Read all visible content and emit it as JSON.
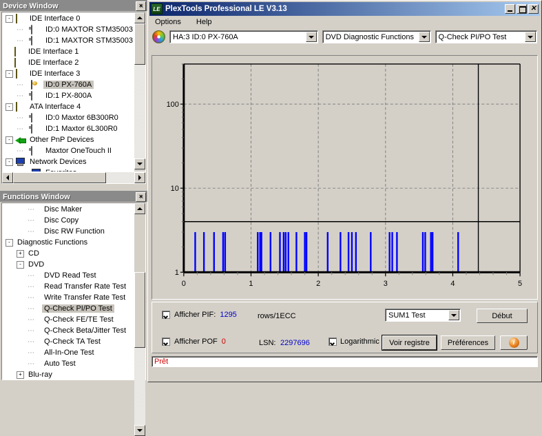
{
  "device_window": {
    "title": "Device Window",
    "close_label": "×",
    "items": [
      {
        "label": "IDE Interface 0",
        "indent": 0,
        "toggle": "-",
        "icon": "ide-card-icon",
        "selected": false
      },
      {
        "label": "ID:0  MAXTOR STM35003",
        "indent": 1,
        "toggle": "",
        "icon": "hard-drive-icon",
        "selected": false
      },
      {
        "label": "ID:1  MAXTOR STM35003",
        "indent": 1,
        "toggle": "",
        "icon": "hard-drive-icon",
        "selected": false
      },
      {
        "label": "IDE Interface 1",
        "indent": 0,
        "toggle": "",
        "icon": "ide-card-icon",
        "selected": false
      },
      {
        "label": "IDE Interface 2",
        "indent": 0,
        "toggle": "",
        "icon": "ide-card-icon",
        "selected": false
      },
      {
        "label": "IDE Interface 3",
        "indent": 0,
        "toggle": "-",
        "icon": "ide-card-icon",
        "selected": false
      },
      {
        "label": "ID:0  PX-760A",
        "indent": 1,
        "toggle": "",
        "icon": "dvd-drive-icon",
        "selected": true
      },
      {
        "label": "ID:1  PX-800A",
        "indent": 1,
        "toggle": "",
        "icon": "hard-drive-icon",
        "selected": false
      },
      {
        "label": "ATA Interface 4",
        "indent": 0,
        "toggle": "-",
        "icon": "ide-card-icon",
        "selected": false
      },
      {
        "label": "ID:0  Maxtor 6B300R0",
        "indent": 1,
        "toggle": "",
        "icon": "hard-drive-icon",
        "selected": false
      },
      {
        "label": "ID:1  Maxtor 6L300R0",
        "indent": 1,
        "toggle": "",
        "icon": "hard-drive-icon",
        "selected": false
      },
      {
        "label": "Other PnP Devices",
        "indent": 0,
        "toggle": "-",
        "icon": "pnp-plug-icon",
        "selected": false
      },
      {
        "label": "Maxtor  OneTouch II",
        "indent": 1,
        "toggle": "",
        "icon": "hard-drive-icon",
        "selected": false
      },
      {
        "label": "Network Devices",
        "indent": 0,
        "toggle": "-",
        "icon": "network-icon",
        "selected": false
      },
      {
        "label": "Favorites",
        "indent": 1,
        "toggle": "",
        "icon": "network-icon",
        "selected": false
      }
    ]
  },
  "functions_window": {
    "title": "Functions Window",
    "close_label": "×",
    "items": [
      {
        "label": "Disc Maker",
        "indent": 2,
        "toggle": "",
        "selected": false
      },
      {
        "label": "Disc Copy",
        "indent": 2,
        "toggle": "",
        "selected": false
      },
      {
        "label": "Disc RW Function",
        "indent": 2,
        "toggle": "",
        "selected": false
      },
      {
        "label": "Diagnostic Functions",
        "indent": 0,
        "toggle": "-",
        "selected": false
      },
      {
        "label": "CD",
        "indent": 1,
        "toggle": "+",
        "selected": false
      },
      {
        "label": "DVD",
        "indent": 1,
        "toggle": "-",
        "selected": false
      },
      {
        "label": "DVD Read Test",
        "indent": 2,
        "toggle": "",
        "selected": false
      },
      {
        "label": "Read Transfer Rate Test",
        "indent": 2,
        "toggle": "",
        "selected": false
      },
      {
        "label": "Write Transfer Rate Test",
        "indent": 2,
        "toggle": "",
        "selected": false
      },
      {
        "label": "Q-Check PI/PO Test",
        "indent": 2,
        "toggle": "",
        "selected": true
      },
      {
        "label": "Q-Check FE/TE Test",
        "indent": 2,
        "toggle": "",
        "selected": false
      },
      {
        "label": "Q-Check Beta/Jitter Test",
        "indent": 2,
        "toggle": "",
        "selected": false
      },
      {
        "label": "Q-Check TA Test",
        "indent": 2,
        "toggle": "",
        "selected": false
      },
      {
        "label": "All-In-One Test",
        "indent": 2,
        "toggle": "",
        "selected": false
      },
      {
        "label": "Auto Test",
        "indent": 2,
        "toggle": "",
        "selected": false
      },
      {
        "label": "Blu-ray",
        "indent": 1,
        "toggle": "+",
        "selected": false
      }
    ]
  },
  "main_window": {
    "title": "PlexTools Professional LE V3.13",
    "logo_text": "LE",
    "minimize_label": "_",
    "maximize_label": "□",
    "close_label": "✕",
    "menu": [
      "Options",
      "Help"
    ],
    "toolbar": {
      "drive_select": "HA:3 ID:0  PX-760A",
      "function_group_select": "DVD Diagnostic Functions",
      "test_select": "Q-Check PI/PO Test"
    },
    "controls": {
      "show_pif_label": "Afficher PIF:",
      "pif_value": "1295",
      "pif_unit": "rows/1ECC",
      "show_pif_checked": true,
      "show_pof_label": "Afficher POF",
      "pof_value": "0",
      "show_pof_checked": true,
      "lsn_label": "LSN:",
      "lsn_value": "2297696",
      "logarithmic_label": "Logarithmic",
      "logarithmic_checked": true,
      "sum_select": "SUM1 Test",
      "start_button": "Début",
      "log_button": "Voir registre",
      "prefs_button": "Préférences",
      "info_button": "i"
    },
    "status": "Prêt"
  },
  "chart_data": {
    "type": "bar",
    "title": "",
    "xlabel": "",
    "ylabel": "",
    "yscale": "log",
    "xlim": [
      0,
      5
    ],
    "ylim": [
      1,
      300
    ],
    "x_ticks": [
      0,
      1,
      2,
      3,
      4,
      5
    ],
    "x_tick_labels": [
      "0",
      "1",
      "2",
      "3",
      "4",
      "5"
    ],
    "y_ticks": [
      1,
      10,
      100
    ],
    "y_tick_labels": [
      "1",
      "10",
      "100"
    ],
    "grid": true,
    "grid_style": "dashed",
    "series_color": "#0000ff",
    "threshold_line_y": 4,
    "data_end_marker_x": 4.38,
    "legend": [],
    "series": [
      {
        "name": "PIF",
        "points": [
          {
            "x": 0.17,
            "y": 3
          },
          {
            "x": 0.3,
            "y": 3
          },
          {
            "x": 0.45,
            "y": 3
          },
          {
            "x": 0.585,
            "y": 3
          },
          {
            "x": 0.615,
            "y": 3
          },
          {
            "x": 1.1,
            "y": 3
          },
          {
            "x": 1.135,
            "y": 3
          },
          {
            "x": 1.155,
            "y": 3
          },
          {
            "x": 1.29,
            "y": 3
          },
          {
            "x": 1.43,
            "y": 3
          },
          {
            "x": 1.485,
            "y": 3
          },
          {
            "x": 1.515,
            "y": 3
          },
          {
            "x": 1.555,
            "y": 3
          },
          {
            "x": 1.675,
            "y": 3
          },
          {
            "x": 1.8,
            "y": 3
          },
          {
            "x": 1.825,
            "y": 3
          },
          {
            "x": 2.14,
            "y": 3
          },
          {
            "x": 2.33,
            "y": 3
          },
          {
            "x": 2.45,
            "y": 3
          },
          {
            "x": 2.5,
            "y": 3
          },
          {
            "x": 2.56,
            "y": 3
          },
          {
            "x": 2.78,
            "y": 3
          },
          {
            "x": 3.06,
            "y": 3
          },
          {
            "x": 3.1,
            "y": 3
          },
          {
            "x": 3.17,
            "y": 3
          },
          {
            "x": 3.555,
            "y": 3
          },
          {
            "x": 3.59,
            "y": 3
          },
          {
            "x": 3.675,
            "y": 3
          },
          {
            "x": 3.7,
            "y": 3
          },
          {
            "x": 4.08,
            "y": 3
          }
        ]
      }
    ]
  }
}
